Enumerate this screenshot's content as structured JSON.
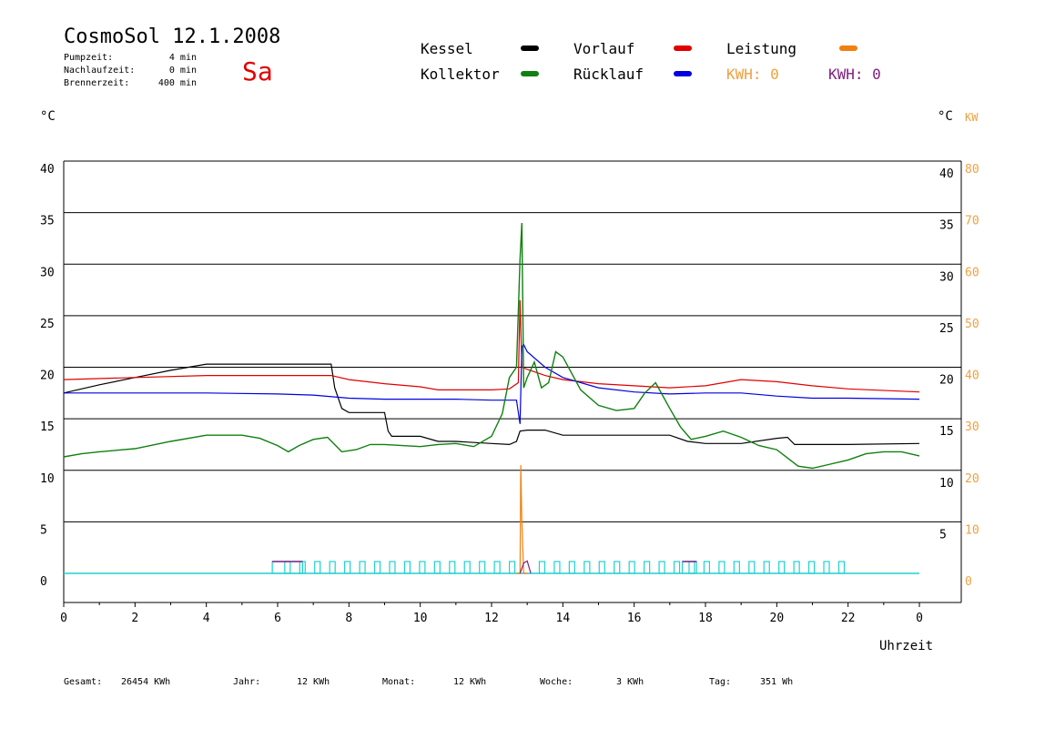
{
  "header": {
    "title": "CosmoSol 12.1.2008",
    "day": "Sa",
    "params": [
      {
        "label": "Pumpzeit:",
        "value": "4 min"
      },
      {
        "label": "Nachlaufzeit:",
        "value": "0 min"
      },
      {
        "label": "Brennerzeit:",
        "value": "400 min"
      }
    ]
  },
  "legend": {
    "kessel": {
      "label": "Kessel",
      "color": "#000000"
    },
    "kollektor": {
      "label": "Kollektor",
      "color": "#108010"
    },
    "vorlauf": {
      "label": "Vorlauf",
      "color": "#e00000"
    },
    "ruecklauf": {
      "label": "Rücklauf",
      "color": "#0000e0"
    },
    "leistung": {
      "label": "Leistung",
      "color": "#f08010"
    },
    "kwh1": {
      "label": "KWH: 0",
      "color": "#f0a040"
    },
    "kwh2": {
      "label": "KWH: 0",
      "color": "#802080"
    }
  },
  "axes": {
    "left_unit": "°C",
    "right_unit": "°C",
    "right_unit2": "KW",
    "xlabel": "Uhrzeit"
  },
  "footer": [
    {
      "label": "Gesamt:",
      "value": "26454 KWh"
    },
    {
      "label": "Jahr:",
      "value": "12 KWh"
    },
    {
      "label": "Monat:",
      "value": "12 KWh"
    },
    {
      "label": "Woche:",
      "value": "3 KWh"
    },
    {
      "label": "Tag:",
      "value": "351 Wh"
    }
  ],
  "chart_data": {
    "type": "line",
    "ylim": [
      0,
      40
    ],
    "ylim_right_kw": [
      0,
      80
    ],
    "x_ticks": [
      "0",
      "2",
      "4",
      "6",
      "8",
      "10",
      "12",
      "14",
      "16",
      "18",
      "20",
      "22",
      "0"
    ],
    "y_ticks_left": [
      "0",
      "5",
      "10",
      "15",
      "20",
      "25",
      "30",
      "35",
      "40"
    ],
    "y_ticks_right": [
      "5",
      "10",
      "15",
      "20",
      "25",
      "30",
      "35",
      "40"
    ],
    "y_ticks_right_kw": [
      "0",
      "10",
      "20",
      "30",
      "40",
      "50",
      "60",
      "70",
      "80"
    ],
    "grid": true,
    "series": [
      {
        "name": "Kessel",
        "color": "#000000",
        "x": [
          0,
          1,
          2,
          3,
          4,
          4.5,
          7.5,
          7.6,
          7.8,
          8,
          9,
          9.1,
          9.2,
          10,
          10.5,
          11,
          12,
          12.5,
          12.7,
          12.8,
          13,
          13.5,
          14,
          15,
          16,
          17,
          17.5,
          18,
          19,
          20,
          20.3,
          20.5,
          22,
          24
        ],
        "y": [
          17.5,
          18.3,
          19.0,
          19.7,
          20.3,
          20.3,
          20.3,
          18,
          16,
          15.6,
          15.6,
          13.8,
          13.3,
          13.3,
          12.8,
          12.8,
          12.6,
          12.5,
          12.8,
          13.8,
          13.9,
          13.9,
          13.4,
          13.4,
          13.4,
          13.4,
          12.8,
          12.6,
          12.6,
          13.1,
          13.2,
          12.5,
          12.5,
          12.6
        ]
      },
      {
        "name": "Vorlauf",
        "color": "#e00000",
        "x": [
          0,
          2,
          4,
          6,
          7.5,
          8,
          9,
          10,
          10.5,
          11,
          12,
          12.5,
          12.75,
          12.8,
          12.85,
          13,
          13.5,
          14,
          15,
          16,
          17,
          18,
          19,
          20,
          21,
          22,
          24
        ],
        "y": [
          18.8,
          19.0,
          19.2,
          19.2,
          19.2,
          18.8,
          18.4,
          18.1,
          17.8,
          17.8,
          17.8,
          17.9,
          18.5,
          26.5,
          20.0,
          19.8,
          19.2,
          18.8,
          18.4,
          18.2,
          18.0,
          18.2,
          18.8,
          18.6,
          18.2,
          17.9,
          17.6
        ]
      },
      {
        "name": "Rücklauf",
        "color": "#0000e0",
        "x": [
          0,
          2,
          4,
          6,
          7,
          8,
          9,
          10,
          11,
          12,
          12.7,
          12.8,
          12.85,
          12.9,
          13,
          13.5,
          14,
          15,
          16,
          17,
          18,
          19,
          20,
          21,
          22,
          24
        ],
        "y": [
          17.5,
          17.5,
          17.5,
          17.4,
          17.3,
          17.0,
          16.9,
          16.9,
          16.9,
          16.8,
          16.8,
          14.5,
          22.0,
          22.2,
          21.5,
          20.0,
          19.0,
          18.0,
          17.6,
          17.4,
          17.5,
          17.5,
          17.2,
          17.0,
          17.0,
          16.9
        ]
      },
      {
        "name": "Kollektor",
        "color": "#108010",
        "x": [
          0,
          0.5,
          1,
          2,
          3,
          4,
          5,
          5.5,
          6,
          6.3,
          6.6,
          7,
          7.4,
          7.8,
          8.2,
          8.6,
          9,
          10,
          10.5,
          11,
          11.5,
          12,
          12.3,
          12.5,
          12.7,
          12.8,
          12.85,
          12.9,
          13,
          13.2,
          13.4,
          13.6,
          13.8,
          14,
          14.5,
          15,
          15.5,
          16,
          16.3,
          16.6,
          17,
          17.3,
          17.6,
          18,
          18.5,
          19,
          19.5,
          20,
          20.3,
          20.6,
          21,
          21.5,
          22,
          22.5,
          23,
          23.5,
          24
        ],
        "y": [
          11.3,
          11.6,
          11.8,
          12.1,
          12.8,
          13.4,
          13.4,
          13.1,
          12.4,
          11.8,
          12.4,
          13.0,
          13.2,
          11.8,
          12.0,
          12.5,
          12.5,
          12.3,
          12.5,
          12.6,
          12.3,
          13.3,
          15.5,
          19.0,
          20.0,
          30.5,
          34.0,
          18.0,
          19.0,
          20.5,
          18.0,
          18.5,
          21.5,
          21.0,
          17.8,
          16.3,
          15.8,
          16.0,
          17.5,
          18.5,
          16.0,
          14.2,
          13.0,
          13.3,
          13.8,
          13.2,
          12.4,
          12.0,
          11.2,
          10.4,
          10.2,
          10.6,
          11.0,
          11.6,
          11.8,
          11.8,
          11.4
        ]
      },
      {
        "name": "Leistung",
        "color": "#f08010",
        "x": [
          12.7,
          12.8,
          12.82,
          12.85,
          12.9,
          13.0
        ],
        "y": [
          0,
          0,
          10.5,
          5.0,
          0,
          0
        ]
      },
      {
        "name": "Kwh",
        "color": "#802080",
        "x": [
          12.8,
          12.9,
          13.0,
          13.1
        ],
        "y": [
          0,
          1.0,
          1.2,
          0
        ]
      }
    ],
    "pump_segments": [
      {
        "start": 5.85,
        "end": 6.7,
        "color": "#802080"
      },
      {
        "start": 17.35,
        "end": 17.75,
        "color": "#802080"
      }
    ]
  }
}
